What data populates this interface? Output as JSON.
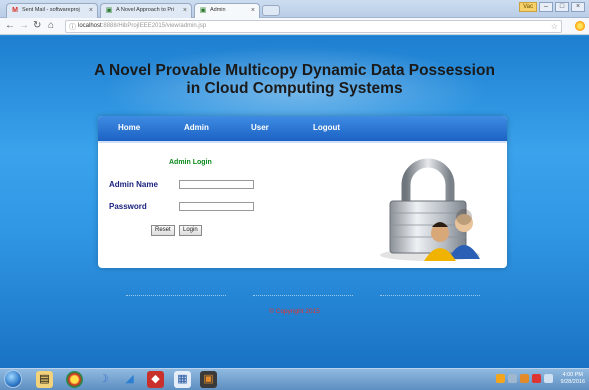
{
  "browser": {
    "tabs": [
      {
        "label": "Sent Mail - softwareproj",
        "icon": "gmail-icon",
        "active": false
      },
      {
        "label": "A Novel Approach to Pri",
        "icon": "page-icon",
        "active": false
      },
      {
        "label": "Admin",
        "icon": "page-icon",
        "active": true
      }
    ],
    "user_badge": "Vac",
    "url_host": "localhost",
    "url_path": ":8888/HibProjIEEE2015/view/admin.jsp"
  },
  "page": {
    "title_line1": "A Novel Provable Multicopy Dynamic Data Possession",
    "title_line2": "in Cloud Computing Systems",
    "menu": [
      "Home",
      "Admin",
      "User",
      "Logout"
    ],
    "login": {
      "heading": "Admin Login",
      "admin_name_label": "Admin Name",
      "password_label": "Password",
      "admin_name_value": "",
      "password_value": "",
      "reset_label": "Reset",
      "login_label": "Login"
    },
    "copyright": "© Copyright 2015"
  },
  "taskbar": {
    "clock_time": "4:00 PM",
    "clock_date": "9/28/2016"
  },
  "colors": {
    "menu_blue": "#1c62c4",
    "login_heading": "#0a8a1a",
    "label_navy": "#1a237e",
    "copyright_red": "#e0332b"
  }
}
